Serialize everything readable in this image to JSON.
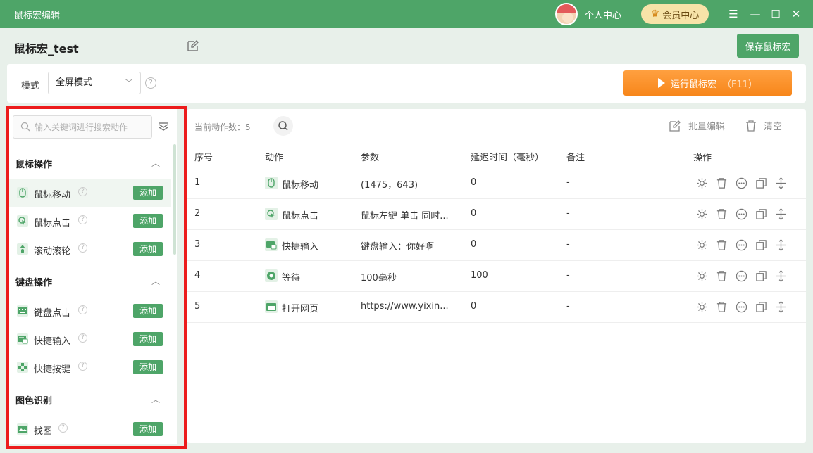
{
  "titlebar": {
    "app_title": "鼠标宏编辑",
    "personal_center": "个人中心",
    "vip": "会员中心"
  },
  "header": {
    "macro_name": "鼠标宏_test",
    "save_label": "保存鼠标宏"
  },
  "mode": {
    "label": "模式",
    "selected": "全屏模式",
    "run_label": "运行鼠标宏",
    "run_key": "（F11）"
  },
  "sidebar": {
    "search_placeholder": "输入关键词进行搜索动作",
    "add_label": "添加",
    "groups": [
      {
        "title": "鼠标操作",
        "items": [
          "鼠标移动",
          "鼠标点击",
          "滚动滚轮"
        ]
      },
      {
        "title": "键盘操作",
        "items": [
          "键盘点击",
          "快捷输入",
          "快捷按键"
        ]
      },
      {
        "title": "图色识别",
        "items": [
          "找图"
        ]
      }
    ]
  },
  "main": {
    "count_label": "当前动作数：",
    "count_value": "5",
    "batch_edit": "批量编辑",
    "clear": "清空",
    "columns": [
      "序号",
      "动作",
      "参数",
      "延迟时间（毫秒）",
      "备注",
      "操作"
    ],
    "rows": [
      {
        "index": "1",
        "action": "鼠标移动",
        "param": "(1475，643)",
        "delay": "0",
        "note": "-"
      },
      {
        "index": "2",
        "action": "鼠标点击",
        "param": "鼠标左键 单击 同时...",
        "delay": "0",
        "note": "-"
      },
      {
        "index": "3",
        "action": "快捷输入",
        "param": "键盘输入：你好啊",
        "delay": "0",
        "note": "-"
      },
      {
        "index": "4",
        "action": "等待",
        "param": "100毫秒",
        "delay": "100",
        "note": "-"
      },
      {
        "index": "5",
        "action": "打开网页",
        "param": "https://www.yixin...",
        "delay": "0",
        "note": "-"
      }
    ]
  },
  "colors": {
    "brand": "#4ea568",
    "run": "#f7861a",
    "highlight": "#ec1c1c"
  }
}
